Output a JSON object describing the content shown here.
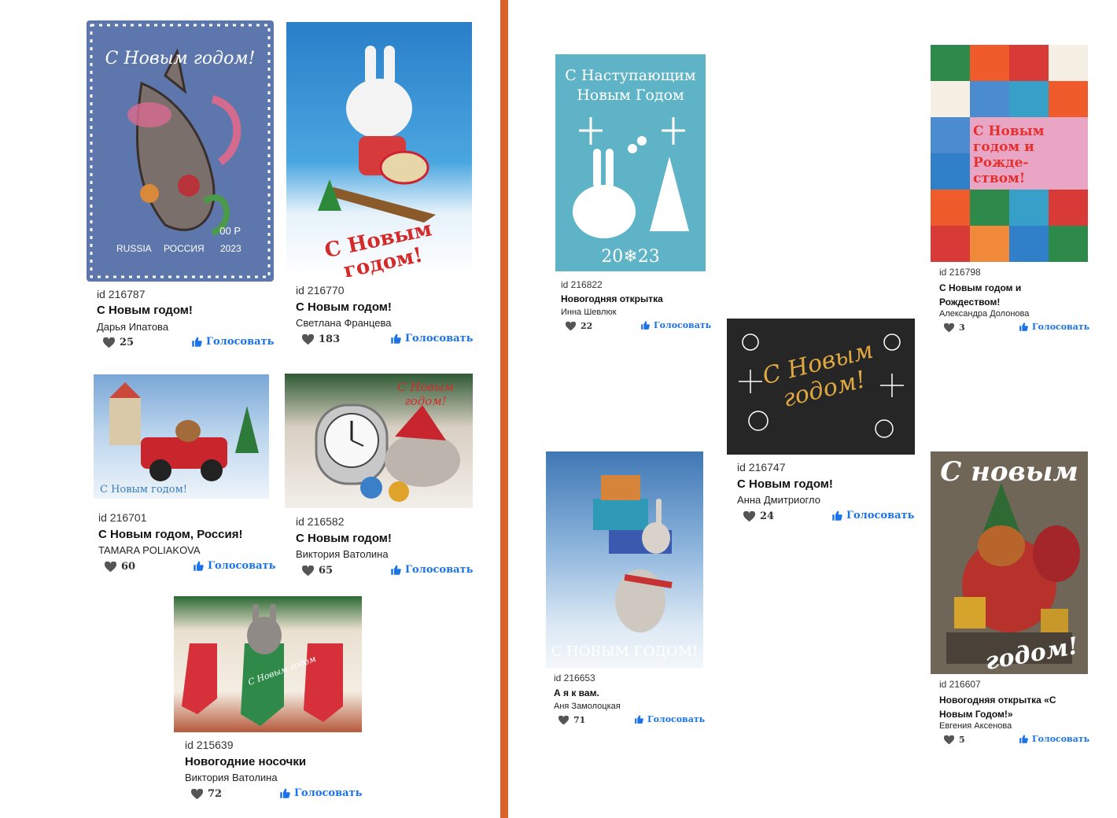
{
  "vote_label": "Голосовать",
  "cards": [
    {
      "id": "id 216787",
      "title": "С Новым годом!",
      "author": "Дарья Ипатова",
      "likes": "25",
      "image_text": [
        "С Новым годом!",
        "00 Р",
        "RUSSIA",
        "РОССИЯ",
        "2023"
      ]
    },
    {
      "id": "id 216770",
      "title": "С Новым годом!",
      "author": "Светлана Францева",
      "likes": "183",
      "image_text": [
        "С Новым годом!"
      ]
    },
    {
      "id": "id 216701",
      "title": "С Новым годом, Россия!",
      "author": "TAMARA POLIAKOVA",
      "likes": "60",
      "image_text": [
        "С Новым годом!"
      ]
    },
    {
      "id": "id 216582",
      "title": "С Новым годом!",
      "author": "Виктория Ватолина",
      "likes": "65",
      "image_text": [
        "С Новым годом!"
      ]
    },
    {
      "id": "id 215639",
      "title": "Новогодние носочки",
      "author": "Виктория Ватолина",
      "likes": "72",
      "image_text": [
        "С Новым годом"
      ]
    },
    {
      "id": "id 216822",
      "title": "Новогодняя открытка",
      "author": "Инна Шевлюк",
      "likes": "22",
      "image_text": [
        "С Наступающим",
        "Новым Годом",
        "20❄23"
      ]
    },
    {
      "id": "id 216798",
      "title": "С Новым годом и Рождеством!",
      "author": "Александра Долонова",
      "likes": "3",
      "image_text": [
        "С Новым годом и Рожде- ством!"
      ]
    },
    {
      "id": "id 216747",
      "title": "С Новым годом!",
      "author": "Анна Дмитриогло",
      "likes": "24",
      "image_text": [
        "С Новым годом!"
      ]
    },
    {
      "id": "id 216653",
      "title": "А я к вам.",
      "author": "Аня Замолоцкая",
      "likes": "71",
      "image_text": [
        "С НОВЫМ ГОДОМ!"
      ]
    },
    {
      "id": "id 216607",
      "title": "Новогодняя открытка «С Новым Годом!»",
      "author": "Евгения Аксенова",
      "likes": "5",
      "image_text": [
        "С новым",
        "годом!"
      ]
    }
  ],
  "colors": {
    "divider": "#d9612c",
    "vote": "#1a73e8",
    "heart": "#555555"
  }
}
